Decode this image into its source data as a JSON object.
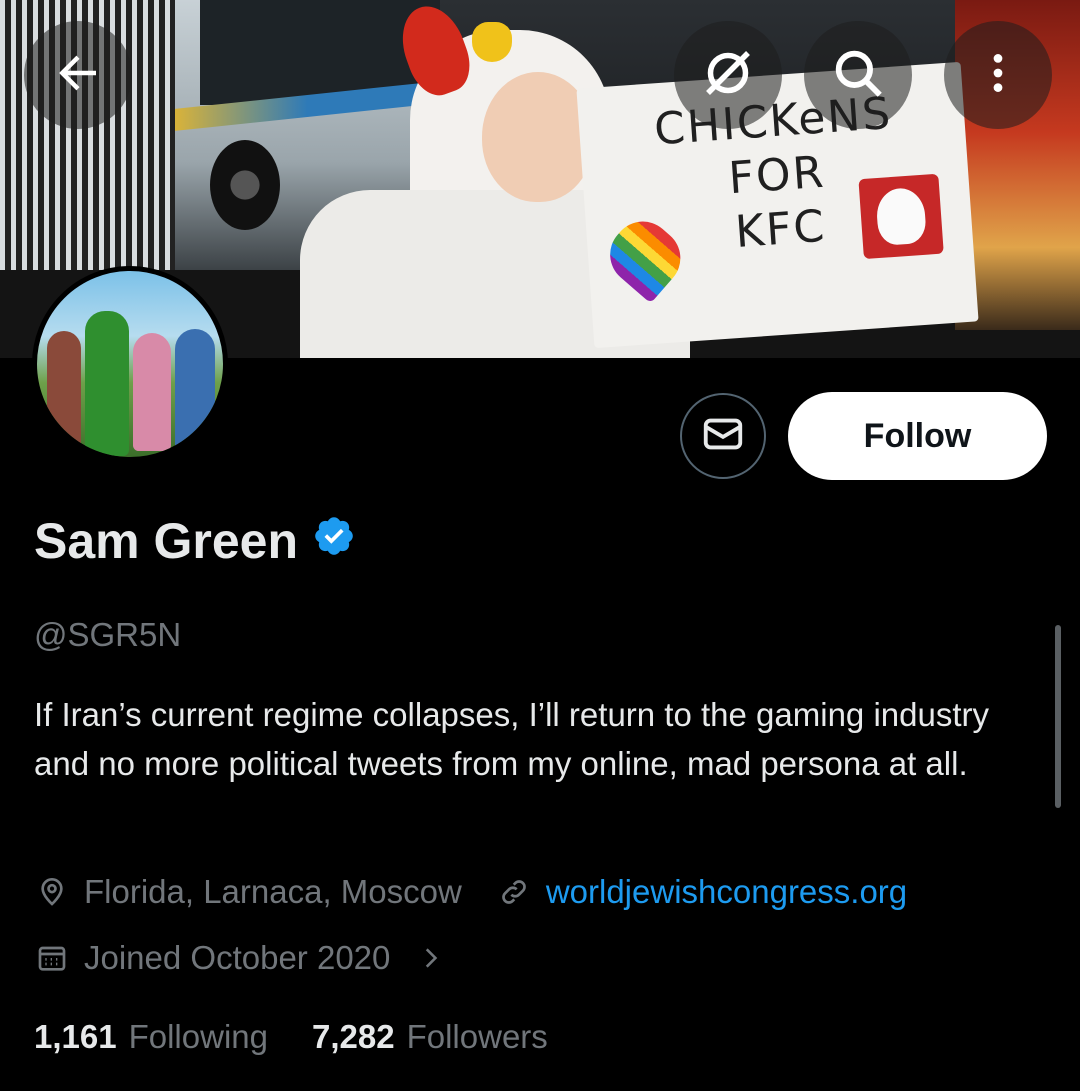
{
  "header": {
    "back_icon": "arrow-left-icon",
    "hide_icon": "eye-slash-icon",
    "search_icon": "search-icon",
    "more_icon": "more-vertical-icon"
  },
  "banner": {
    "sign_line1": "CHICKeNS",
    "sign_line2": "FOR",
    "sign_line3": "KFC"
  },
  "actions": {
    "message_icon": "mail-icon",
    "follow_label": "Follow"
  },
  "profile": {
    "name": "Sam Green",
    "verified_icon": "verified-badge-icon",
    "verified_color": "#1d9bf0",
    "handle": "@SGR5N",
    "bio": "If Iran’s current regime collapses, I’ll return to the gaming industry and no more political tweets from my online, mad persona at all.",
    "location": "Florida, Larnaca, Moscow",
    "website": "worldjewishcongress.org",
    "joined": "Joined October 2020"
  },
  "stats": {
    "following_count": "1,161",
    "following_label": "Following",
    "followers_count": "7,282",
    "followers_label": "Followers"
  }
}
